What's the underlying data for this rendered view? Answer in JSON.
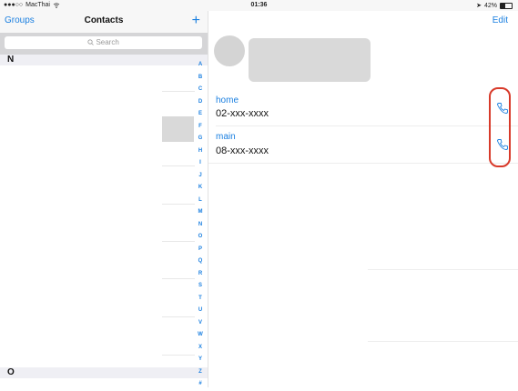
{
  "status_bar": {
    "carrier": "MacThai",
    "time": "01:36",
    "battery": "42%"
  },
  "contacts_list": {
    "groups_label": "Groups",
    "title": "Contacts",
    "add_label": "+",
    "search_placeholder": "Search",
    "sections": [
      "N",
      "O"
    ],
    "index": [
      "A",
      "B",
      "C",
      "D",
      "E",
      "F",
      "G",
      "H",
      "I",
      "J",
      "K",
      "L",
      "M",
      "N",
      "O",
      "P",
      "Q",
      "R",
      "S",
      "T",
      "U",
      "V",
      "W",
      "X",
      "Y",
      "Z",
      "#"
    ]
  },
  "contact_detail": {
    "edit_label": "Edit",
    "phones": [
      {
        "label": "home",
        "number": "02-xxx-xxxx"
      },
      {
        "label": "main",
        "number": "08-xxx-xxxx"
      }
    ]
  },
  "colors": {
    "accent": "#1a7fe0",
    "highlight": "#d83a2a"
  }
}
